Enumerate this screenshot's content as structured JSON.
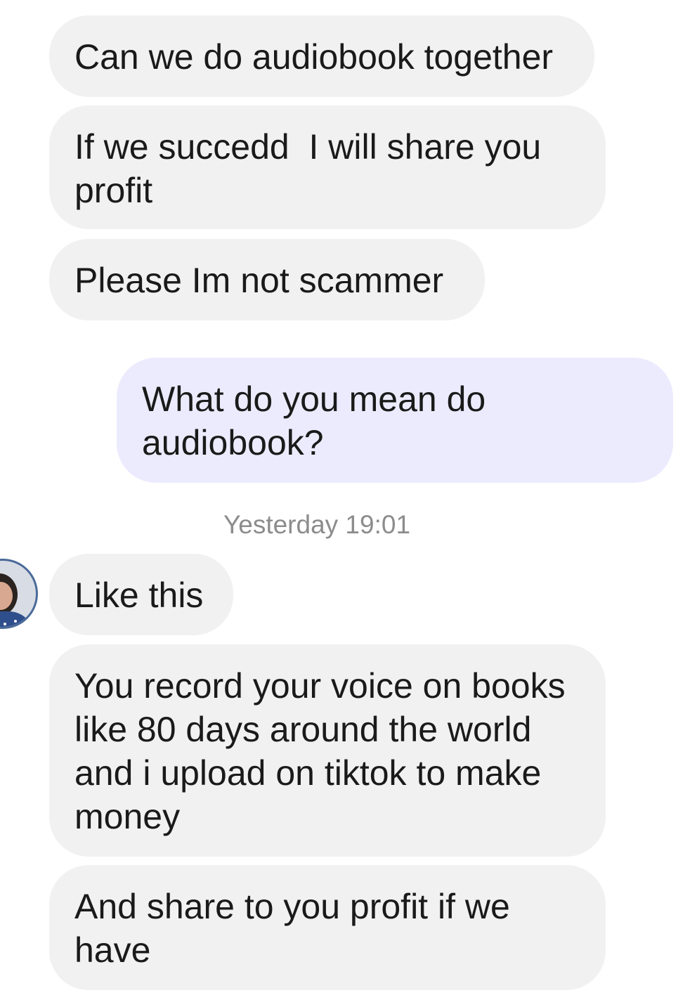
{
  "conversation": {
    "messages": [
      {
        "direction": "incoming",
        "text": "Can we do audiobook together"
      },
      {
        "direction": "incoming",
        "text": "If we succedd  I will share you profit"
      },
      {
        "direction": "incoming",
        "text": "Please Im not scammer"
      },
      {
        "direction": "outgoing",
        "text": "What do you mean do audiobook?"
      },
      {
        "direction": "incoming",
        "text": "Like this"
      },
      {
        "direction": "incoming",
        "text": "You record your voice on books like 80 days around the world and i upload on tiktok to make money"
      },
      {
        "direction": "incoming",
        "text": "And share to you profit if we have"
      }
    ],
    "timestamp": "Yesterday 19:01"
  },
  "colors": {
    "incoming_bubble": "#f1f1f1",
    "outgoing_bubble": "#ecebfe",
    "timestamp_text": "#8c8c8c"
  }
}
